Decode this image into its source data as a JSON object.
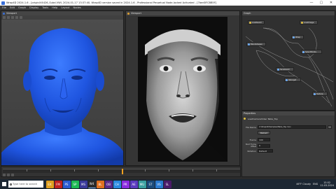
{
  "window": {
    "title": "Wrap4D 2024.1.6 - [origin/V4426_Subd.VWI, 2024-01-17 13:37:40, Wrap4D version saved in 2024.1.6 - Professional Perpetual Node-locked Activated - [7bed0FCBB5F]",
    "minimize": "—",
    "maximize": "▢",
    "close": "✕"
  },
  "menu": [
    "File",
    "Edit",
    "Graph",
    "Display",
    "Tools",
    "Help",
    "Layout",
    "Nodes"
  ],
  "viewport_left": {
    "title": "Viewport",
    "accent": "#3a6fd8"
  },
  "viewport_center": {
    "title": "Viewport",
    "accent": "#e0a030"
  },
  "node_graph": {
    "title": "Graph",
    "nodes": [
      {
        "label": "LoadGeom",
        "color": "#e0c040"
      },
      {
        "label": "LoadImage",
        "color": "#e0c040"
      },
      {
        "label": "Wrap",
        "color": "#6fb0ff"
      },
      {
        "label": "Blendshapes",
        "color": "#6fb0ff"
      },
      {
        "label": "SelectPoints",
        "color": "#6fb0ff"
      },
      {
        "label": "SaveGeom",
        "color": "#6fb0ff"
      },
      {
        "label": "Retarget",
        "color": "#6fb0ff"
      },
      {
        "label": "Texture",
        "color": "#6fb0ff"
      }
    ]
  },
  "properties": {
    "title": "Properties",
    "node_name": "LoadCameraVideo Table_Top",
    "file_label": "File Name",
    "file_value": "C:\\Wrap4D\\Samples\\Table_Top.mov",
    "reload_label": "Reload",
    "frame_label": "Frame",
    "frame_value": "190",
    "offset_label": "Start Frame Offset",
    "offset_value": "0",
    "rotation_label": "Rotation",
    "rotation_value": "Default"
  },
  "timeline": {
    "playhead": 0.5
  },
  "taskbar": {
    "search_placeholder": "Type here to search",
    "apps": [
      "EX",
      "FM",
      "PS",
      "SP",
      "MS",
      "W4",
      "BL",
      "OB",
      "CH",
      "PR",
      "AE",
      "MU",
      "ST",
      "VS",
      "SL"
    ],
    "weather": "46°F Cloudy",
    "lang": "ENG",
    "time": "15:52",
    "date": "12-03-2024"
  },
  "colors": {
    "accent_blue": "#3a6fd8",
    "accent_orange": "#f0a020",
    "taskbar": "#1c2733"
  }
}
